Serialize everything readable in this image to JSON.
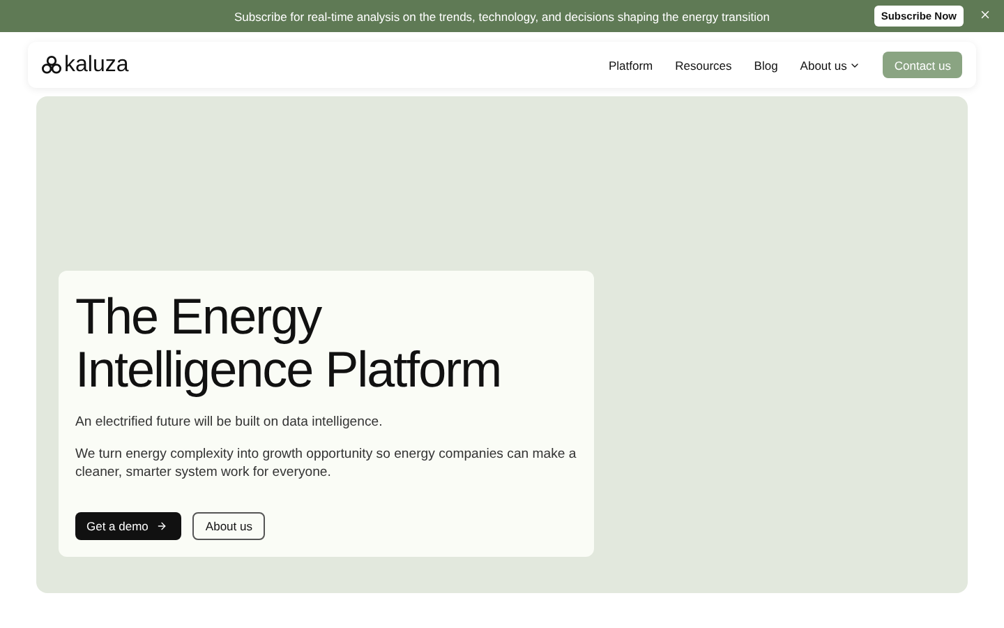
{
  "banner": {
    "text": "Subscribe for real-time analysis on the trends, technology, and decisions shaping the energy transition",
    "button": "Subscribe Now"
  },
  "nav": {
    "logo": "kaluza",
    "items": [
      {
        "label": "Platform",
        "dropdown": false
      },
      {
        "label": "Resources",
        "dropdown": false
      },
      {
        "label": "Blog",
        "dropdown": false
      },
      {
        "label": "About us",
        "dropdown": true
      }
    ],
    "cta": "Contact us"
  },
  "hero": {
    "title_lines": [
      "The Energy",
      "Intelligence Platform"
    ],
    "paragraphs": [
      "An electrified future will be built on data intelligence.",
      "We turn energy complexity into growth opportunity so energy companies can make a cleaner, smarter system work for everyone."
    ],
    "primary_button": "Get a demo",
    "secondary_button": "About us"
  }
}
